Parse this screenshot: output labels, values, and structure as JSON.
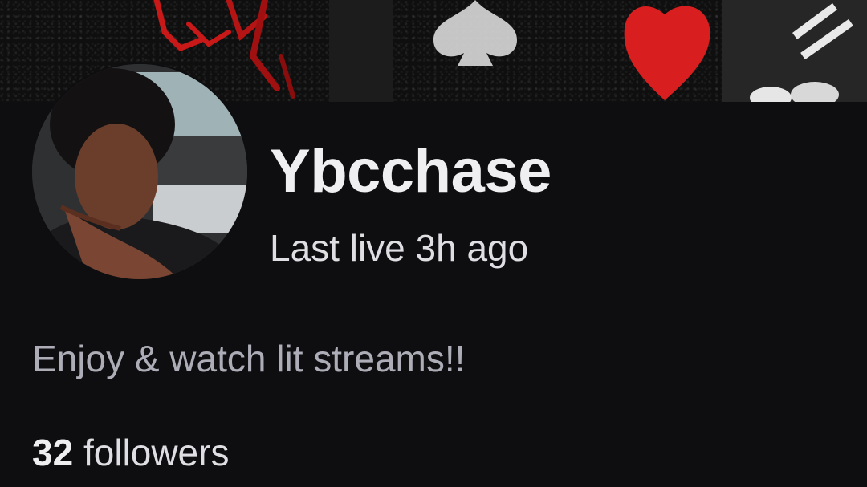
{
  "profile": {
    "channel_name": "Ybcchase",
    "last_live": "Last live 3h ago",
    "bio": "Enjoy & watch lit streams!!",
    "followers_count": "32",
    "followers_label": "followers"
  },
  "banner": {
    "icons": [
      "spade-icon",
      "heart-icon"
    ]
  },
  "colors": {
    "background": "#0e0e10",
    "primary_text": "#efeff1",
    "secondary_text": "#adadb8",
    "banner_red": "#d81e1e"
  }
}
